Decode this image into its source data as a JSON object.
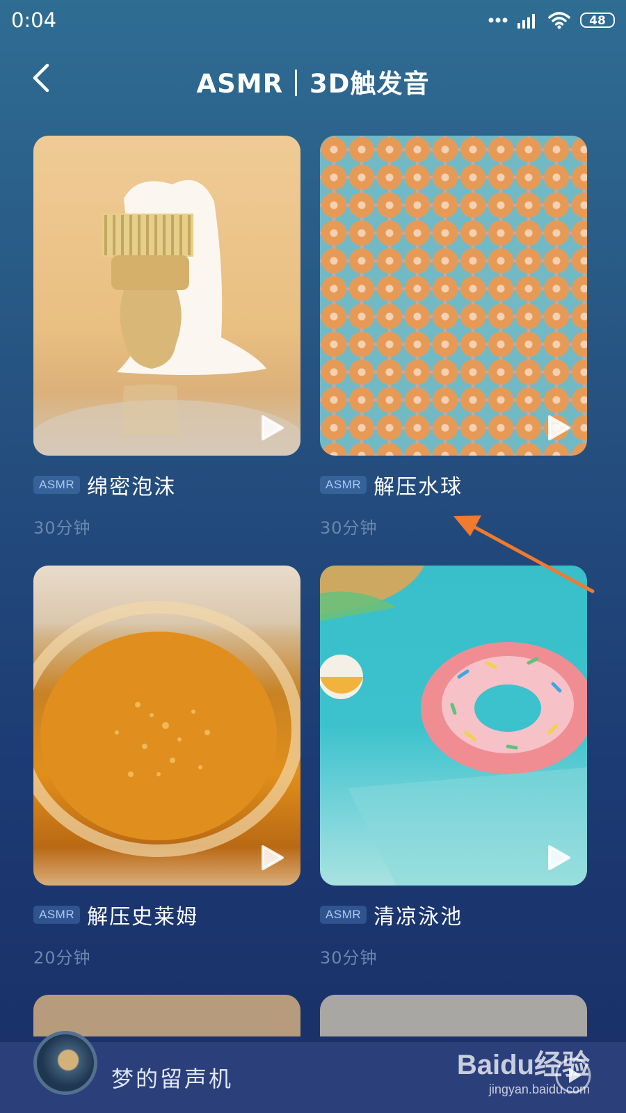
{
  "status_bar": {
    "time": "0:04",
    "battery": "48"
  },
  "header": {
    "title": "ASMR｜3D触发音"
  },
  "cards": [
    {
      "tag": "ASMR",
      "title": "绵密泡沫",
      "duration": "30分钟"
    },
    {
      "tag": "ASMR",
      "title": "解压水球",
      "duration": "30分钟"
    },
    {
      "tag": "ASMR",
      "title": "解压史莱姆",
      "duration": "20分钟"
    },
    {
      "tag": "ASMR",
      "title": "清凉泳池",
      "duration": "30分钟"
    }
  ],
  "player": {
    "title": "梦的留声机"
  },
  "watermark": {
    "logo": "Baidu经验",
    "url": "jingyan.baidu.com"
  },
  "colors": {
    "annotation_arrow": "#f07a2e",
    "tag_text": "#a9c8f0",
    "duration_text": "#6c88ac"
  }
}
